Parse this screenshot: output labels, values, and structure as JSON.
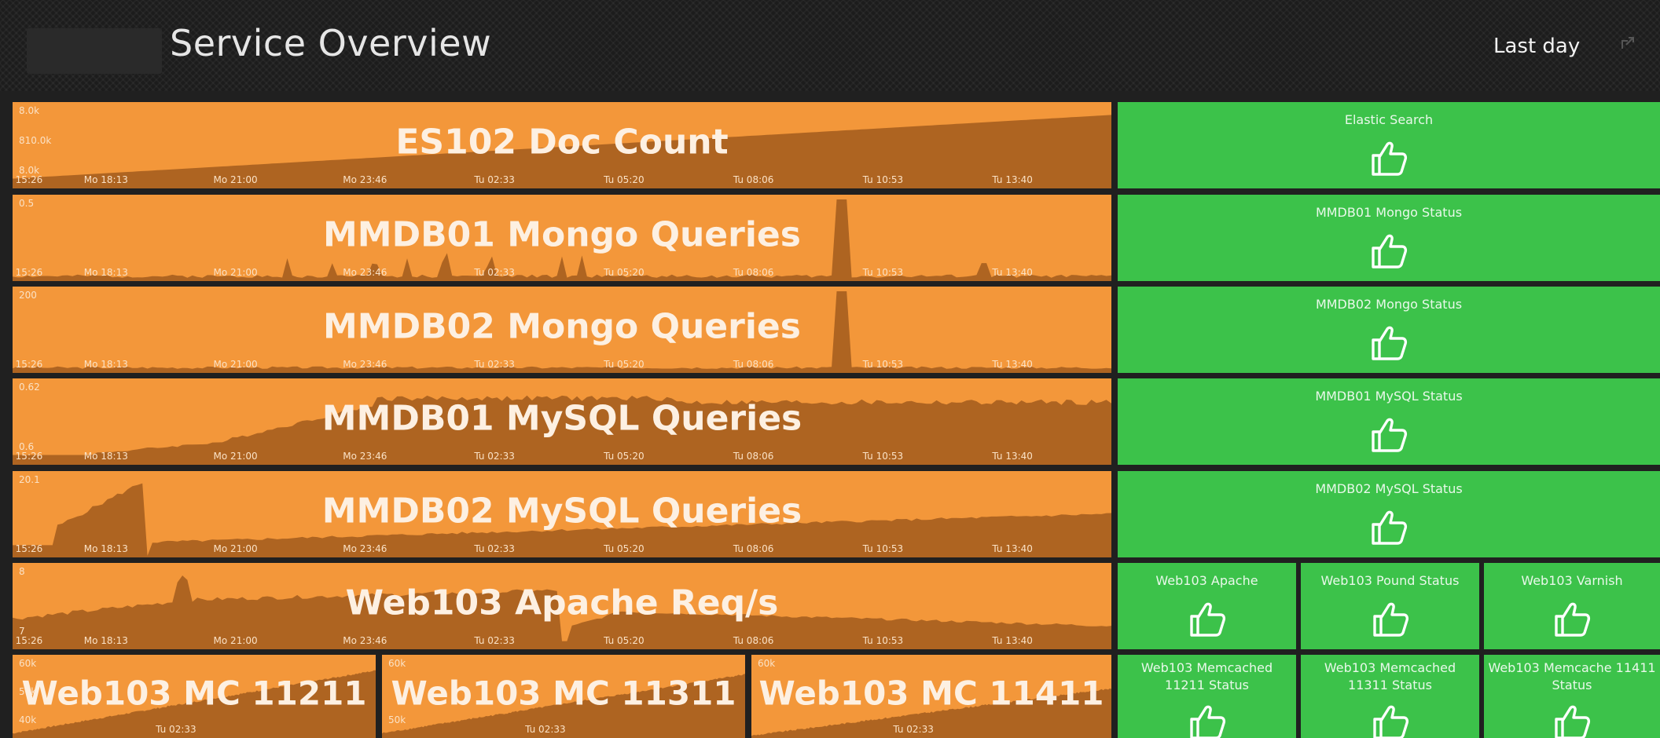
{
  "header": {
    "title": "Service Overview",
    "time_range": "Last day",
    "refresh_icon": "share-icon"
  },
  "colors": {
    "graph_bg": "#f3973a",
    "graph_area": "#a45d1e",
    "status_ok": "#3cc24a"
  },
  "graphs": [
    {
      "title": "ES102 Doc Count",
      "y_labels": [
        "8.0k",
        "810.0k",
        "8.0k"
      ],
      "x_ticks": [
        "15:26",
        "Mo 18:13",
        "Mo 21:00",
        "Mo 23:46",
        "Tu 02:33",
        "Tu 05:20",
        "Tu 08:06",
        "Tu 10:53",
        "Tu 13:40"
      ]
    },
    {
      "title": "MMDB01 Mongo Queries",
      "y_labels": [
        "0.5"
      ],
      "x_ticks": [
        "15:26",
        "Mo 18:13",
        "Mo 21:00",
        "Mo 23:46",
        "Tu 02:33",
        "Tu 05:20",
        "Tu 08:06",
        "Tu 10:53",
        "Tu 13:40"
      ]
    },
    {
      "title": "MMDB02 Mongo Queries",
      "y_labels": [
        "200"
      ],
      "x_ticks": [
        "15:26",
        "Mo 18:13",
        "Mo 21:00",
        "Mo 23:46",
        "Tu 02:33",
        "Tu 05:20",
        "Tu 08:06",
        "Tu 10:53",
        "Tu 13:40"
      ]
    },
    {
      "title": "MMDB01 MySQL Queries",
      "y_labels": [
        "0.62",
        "0.6"
      ],
      "x_ticks": [
        "15:26",
        "Mo 18:13",
        "Mo 21:00",
        "Mo 23:46",
        "Tu 02:33",
        "Tu 05:20",
        "Tu 08:06",
        "Tu 10:53",
        "Tu 13:40"
      ]
    },
    {
      "title": "MMDB02 MySQL Queries",
      "y_labels": [
        "20.1"
      ],
      "x_ticks": [
        "15:26",
        "Mo 18:13",
        "Mo 21:00",
        "Mo 23:46",
        "Tu 02:33",
        "Tu 05:20",
        "Tu 08:06",
        "Tu 10:53",
        "Tu 13:40"
      ]
    },
    {
      "title": "Web103 Apache Req/s",
      "y_labels": [
        "8",
        "7"
      ],
      "x_ticks": [
        "15:26",
        "Mo 18:13",
        "Mo 21:00",
        "Mo 23:46",
        "Tu 02:33",
        "Tu 05:20",
        "Tu 08:06",
        "Tu 10:53",
        "Tu 13:40"
      ]
    },
    {
      "title": "Web103 MC 11211",
      "y_labels": [
        "60k",
        "50k",
        "40k"
      ],
      "x_ticks": [
        "Tu 02:33"
      ]
    },
    {
      "title": "Web103 MC 11311",
      "y_labels": [
        "60k",
        "50k"
      ],
      "x_ticks": [
        "Tu 02:33"
      ]
    },
    {
      "title": "Web103 MC 11411",
      "y_labels": [
        "60k"
      ],
      "x_ticks": [
        "Tu 02:33"
      ]
    }
  ],
  "statuses": [
    {
      "label": "Elastic Search",
      "state": "ok",
      "icon": "thumbs-up-icon"
    },
    {
      "label": "MMDB01 Mongo Status",
      "state": "ok",
      "icon": "thumbs-up-icon"
    },
    {
      "label": "MMDB02 Mongo Status",
      "state": "ok",
      "icon": "thumbs-up-icon"
    },
    {
      "label": "MMDB01 MySQL Status",
      "state": "ok",
      "icon": "thumbs-up-icon"
    },
    {
      "label": "MMDB02 MySQL Status",
      "state": "ok",
      "icon": "thumbs-up-icon"
    },
    {
      "label": "Web103 Apache",
      "state": "ok",
      "icon": "thumbs-up-icon"
    },
    {
      "label": "Web103 Pound Status",
      "state": "ok",
      "icon": "thumbs-up-icon"
    },
    {
      "label": "Web103 Varnish",
      "state": "ok",
      "icon": "thumbs-up-icon"
    },
    {
      "label": "Web103 Memcached 11211 Status",
      "state": "ok",
      "icon": "thumbs-up-icon"
    },
    {
      "label": "Web103 Memcached 11311 Status",
      "state": "ok",
      "icon": "thumbs-up-icon"
    },
    {
      "label": "Web103 Memcache 11411 Status",
      "state": "ok",
      "icon": "thumbs-up-icon"
    }
  ]
}
